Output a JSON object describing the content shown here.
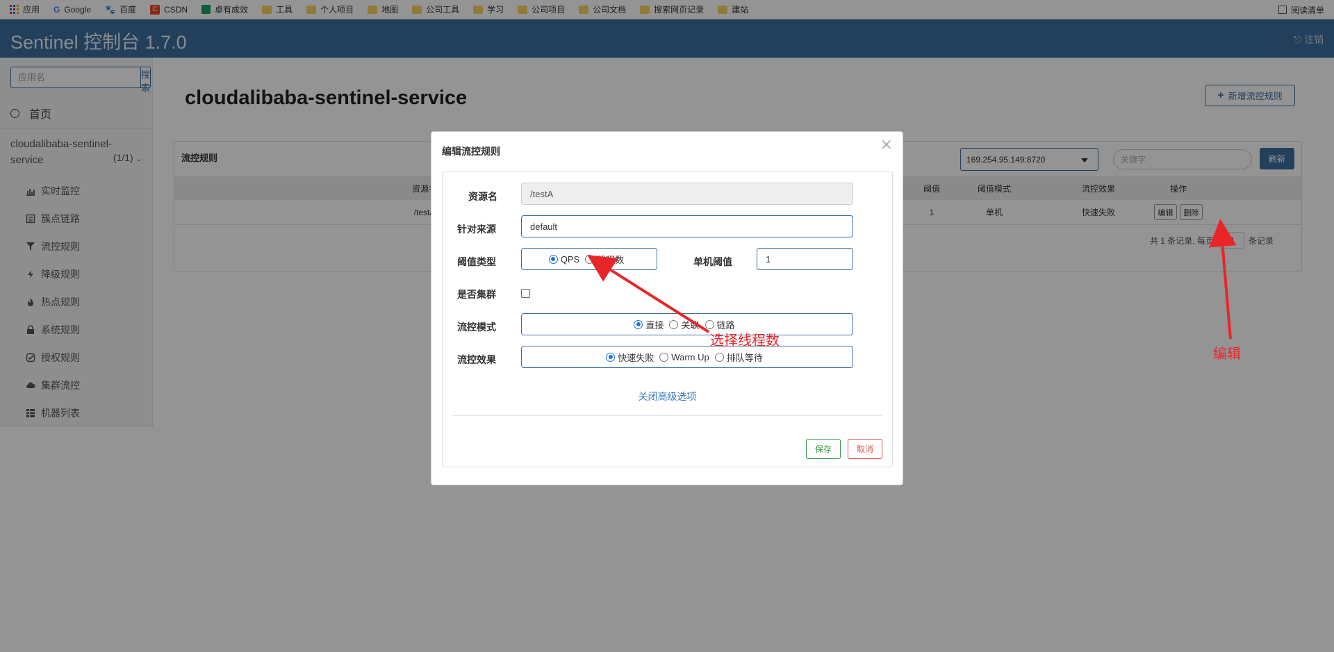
{
  "bookmarks": {
    "items": [
      "应用",
      "Google",
      "百度",
      "CSDN",
      "卓有成效",
      "工具",
      "个人项目",
      "地图",
      "公司工具",
      "学习",
      "公司项目",
      "公司文档",
      "搜索网页记录",
      "建站"
    ],
    "reading_list": "阅读清单"
  },
  "header": {
    "title": "Sentinel 控制台 1.7.0",
    "logout": "注销"
  },
  "sidebar": {
    "search_placeholder": "应用名",
    "search_button": "搜索",
    "home": "首页",
    "app_name": "cloudalibaba-sentinel-service",
    "app_count": "(1/1)",
    "items": [
      {
        "label": "实时监控",
        "icon": "bar-chart-icon"
      },
      {
        "label": "簇点链路",
        "icon": "list-icon"
      },
      {
        "label": "流控规则",
        "icon": "filter-icon"
      },
      {
        "label": "降级规则",
        "icon": "bolt-icon"
      },
      {
        "label": "热点规则",
        "icon": "fire-icon"
      },
      {
        "label": "系统规则",
        "icon": "lock-icon"
      },
      {
        "label": "授权规则",
        "icon": "check-circle-icon"
      },
      {
        "label": "集群流控",
        "icon": "cloud-icon"
      },
      {
        "label": "机器列表",
        "icon": "grid-icon"
      }
    ]
  },
  "main": {
    "title": "cloudalibaba-sentinel-service",
    "add_button": "新增流控规则",
    "panel_title": "流控规则",
    "machine": "169.254.95.149:8720",
    "keyword_placeholder": "关键字",
    "refresh": "刷新",
    "columns": [
      "资源名",
      "阈值",
      "阈值模式",
      "流控效果",
      "操作"
    ],
    "row": {
      "resource": "/testA",
      "threshold": "1",
      "mode": "单机",
      "effect": "快速失败"
    },
    "edit_button": "编辑",
    "delete_button": "删除",
    "pager_prefix": "共 1 条记录, 每页",
    "page_size": "10",
    "pager_suffix": "条记录"
  },
  "modal": {
    "title": "编辑流控规则",
    "close": "×",
    "resource_label": "资源名",
    "resource_value": "/testA",
    "origin_label": "针对来源",
    "origin_value": "default",
    "grade_label": "阈值类型",
    "grade_options": [
      "QPS",
      "线程数"
    ],
    "grade_selected": "QPS",
    "count_label": "单机阈值",
    "count_value": "1",
    "cluster_label": "是否集群",
    "cluster_checked": false,
    "strategy_label": "流控模式",
    "strategy_options": [
      "直接",
      "关联",
      "链路"
    ],
    "strategy_selected": "直接",
    "effect_label": "流控效果",
    "effect_options": [
      "快速失败",
      "Warm Up",
      "排队等待"
    ],
    "effect_selected": "快速失败",
    "advanced_link": "关闭高级选项",
    "save": "保存",
    "cancel": "取消"
  },
  "annotations": {
    "thread_note": "选择线程数",
    "edit_note": "编辑",
    "color": "#e8262a"
  }
}
